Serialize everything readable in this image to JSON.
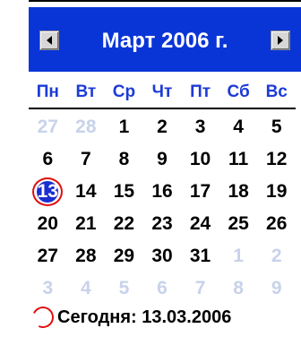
{
  "calendar": {
    "title": "Март 2006 г.",
    "weekdays": [
      "Пн",
      "Вт",
      "Ср",
      "Чт",
      "Пт",
      "Сб",
      "Вс"
    ],
    "days": [
      {
        "label": "27",
        "other": true
      },
      {
        "label": "28",
        "other": true
      },
      {
        "label": "1"
      },
      {
        "label": "2"
      },
      {
        "label": "3"
      },
      {
        "label": "4"
      },
      {
        "label": "5"
      },
      {
        "label": "6"
      },
      {
        "label": "7"
      },
      {
        "label": "8"
      },
      {
        "label": "9"
      },
      {
        "label": "10"
      },
      {
        "label": "11"
      },
      {
        "label": "12"
      },
      {
        "label": "13",
        "today": true
      },
      {
        "label": "14"
      },
      {
        "label": "15"
      },
      {
        "label": "16"
      },
      {
        "label": "17"
      },
      {
        "label": "18"
      },
      {
        "label": "19"
      },
      {
        "label": "20"
      },
      {
        "label": "21"
      },
      {
        "label": "22"
      },
      {
        "label": "23"
      },
      {
        "label": "24"
      },
      {
        "label": "25"
      },
      {
        "label": "26"
      },
      {
        "label": "27"
      },
      {
        "label": "28"
      },
      {
        "label": "29"
      },
      {
        "label": "30"
      },
      {
        "label": "31"
      },
      {
        "label": "1",
        "other": true
      },
      {
        "label": "2",
        "other": true
      },
      {
        "label": "3",
        "other": true
      },
      {
        "label": "4",
        "other": true
      },
      {
        "label": "5",
        "other": true
      },
      {
        "label": "6",
        "other": true
      },
      {
        "label": "7",
        "other": true
      },
      {
        "label": "8",
        "other": true
      },
      {
        "label": "9",
        "other": true
      }
    ],
    "footer_label": "Сегодня: 13.03.2006"
  },
  "colors": {
    "header_bg": "#0a35d6",
    "weekday_text": "#1d3bd6",
    "other_month_text": "#c8d2ea",
    "today_circle": "#e01010"
  },
  "icons": {
    "prev": "left-triangle-icon",
    "next": "right-triangle-icon"
  }
}
